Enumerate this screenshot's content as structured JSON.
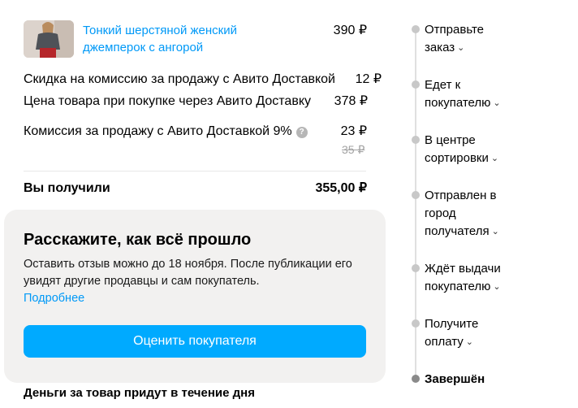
{
  "product": {
    "title": "Тонкий шерстяной женский джемперок с ангорой",
    "price": "390 ₽"
  },
  "breakdown": [
    {
      "label": "Скидка на комиссию за продажу с Авито Доставкой",
      "value": "12 ₽"
    },
    {
      "label": "Цена товара при покупке через Авито Доставку",
      "value": "378 ₽"
    },
    {
      "label": "Комиссия за продажу с Авито Доставкой 9%",
      "value": "23 ₽",
      "old_value": "35 ₽"
    }
  ],
  "total": {
    "label": "Вы получили",
    "value": "355,00 ₽"
  },
  "review": {
    "title": "Расскажите, как всё прошло",
    "text": "Оставить отзыв можно до 18 ноября. После публикации его увидят другие продавцы и сам покупатель.",
    "link": "Подробнее",
    "button": "Оценить покупателя"
  },
  "footer_note": "Деньги за товар придут в течение дня",
  "timeline": [
    {
      "label": "Отправьте заказ"
    },
    {
      "label": "Едет к покупателю"
    },
    {
      "label": "В центре сортировки"
    },
    {
      "label": "Отправлен в город получателя"
    },
    {
      "label": "Ждёт выдачи покупателю"
    },
    {
      "label": "Получите оплату"
    },
    {
      "label": "Завершён"
    }
  ],
  "colors": {
    "link": "#0099f7",
    "button": "#00aaff",
    "card_bg": "#f2f1f0",
    "strikethrough": "#a3a3a3"
  }
}
